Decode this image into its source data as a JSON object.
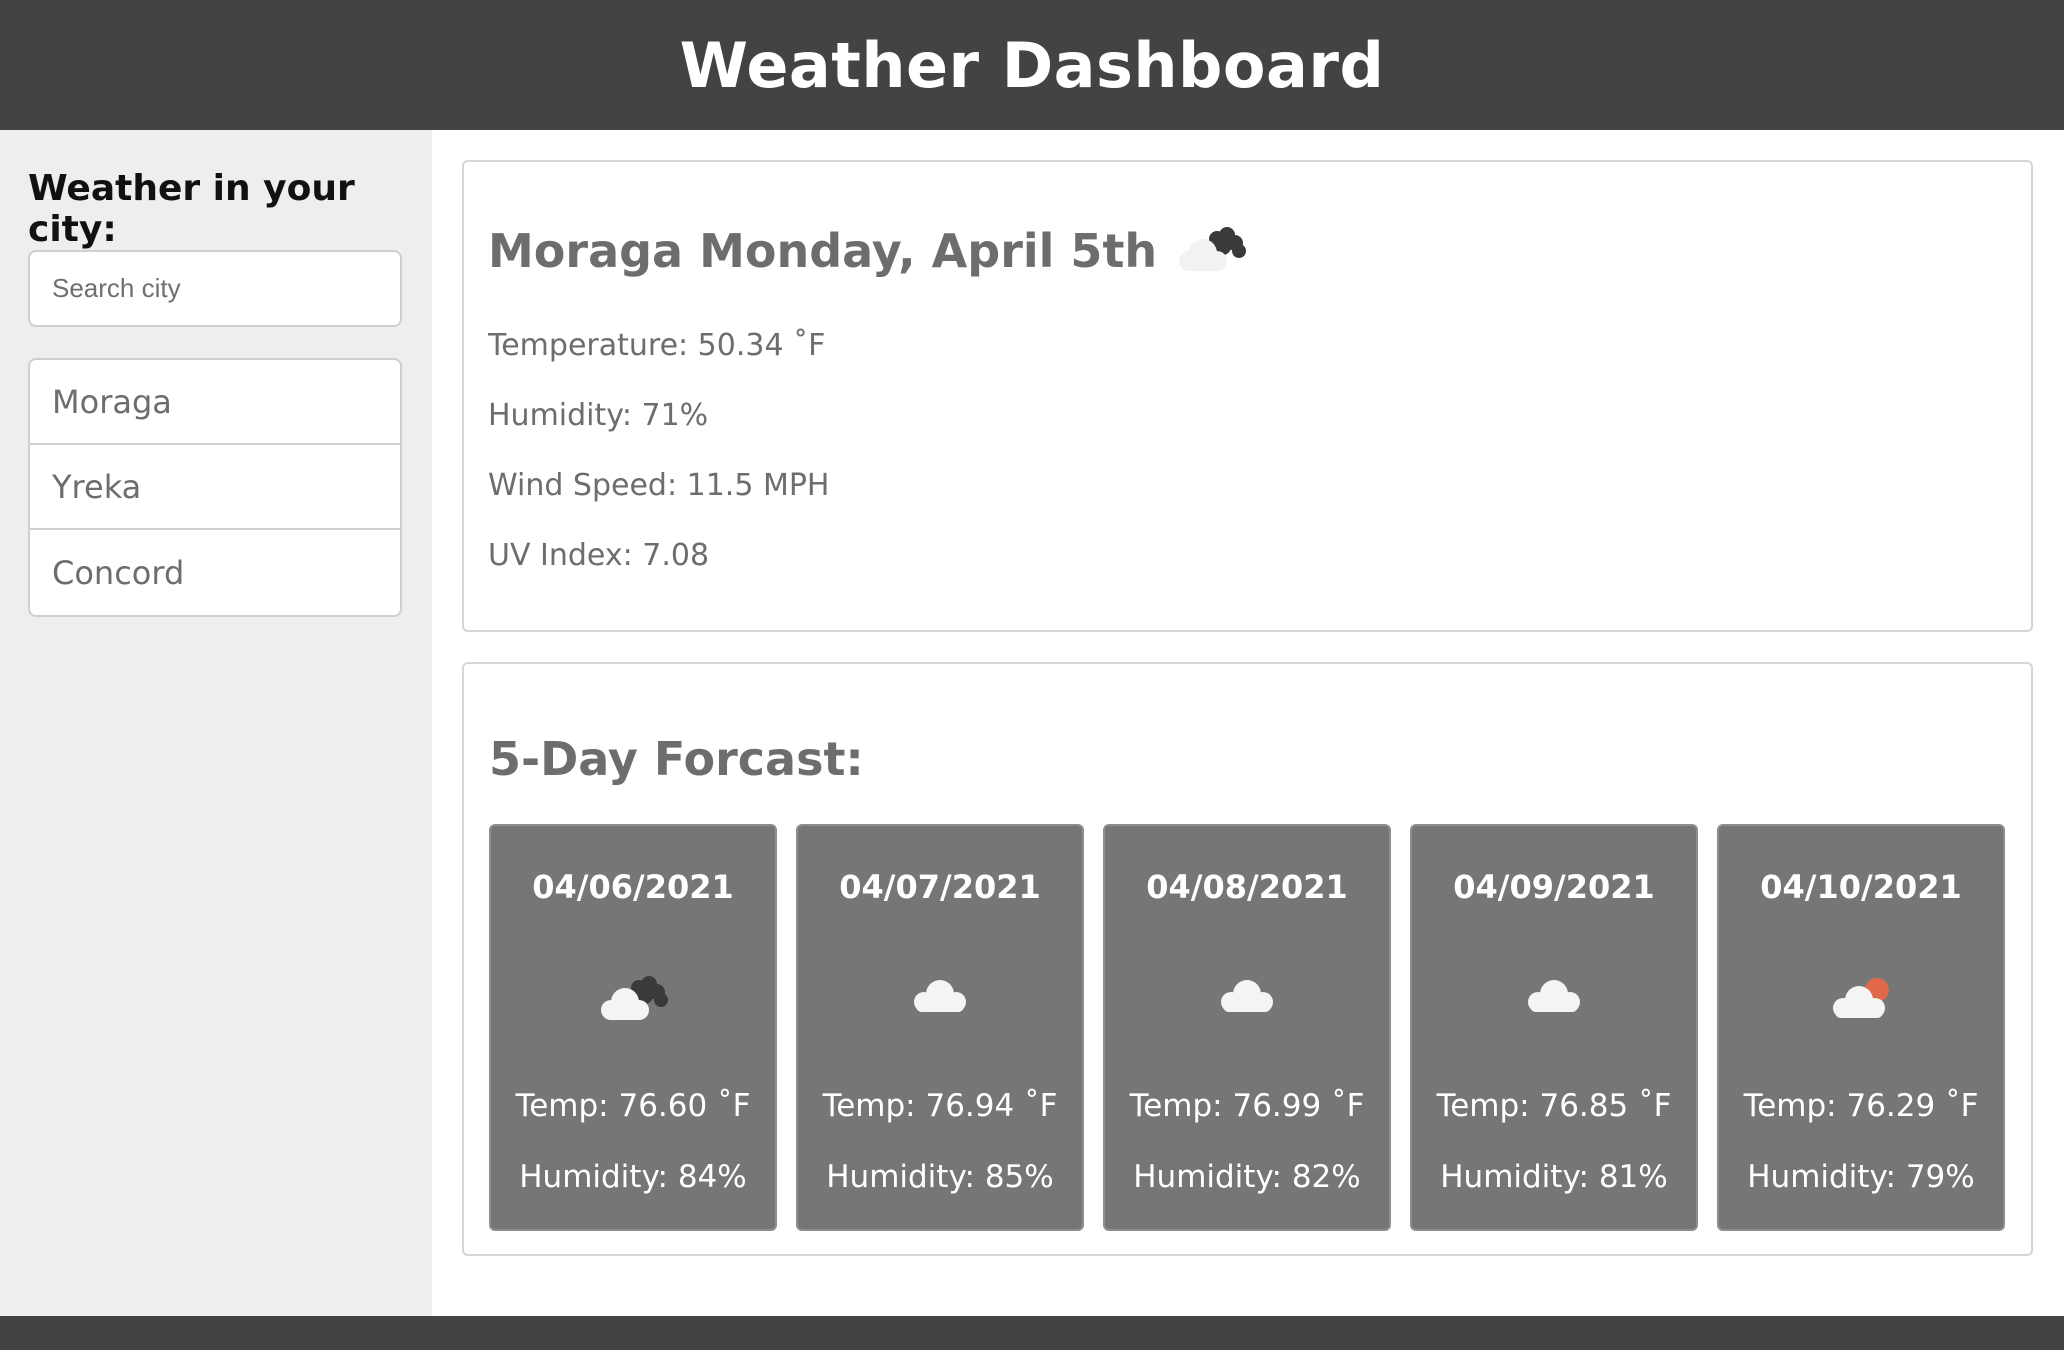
{
  "header": {
    "title": "Weather Dashboard"
  },
  "sidebar": {
    "title": "Weather in your city:",
    "search": {
      "placeholder": "Search city",
      "value": ""
    },
    "cities": [
      "Moraga",
      "Yreka",
      "Concord"
    ]
  },
  "current": {
    "title": "Moraga Monday, April 5th",
    "icon": "cloudy-night-icon",
    "temperature": "Temperature: 50.34 ˚F",
    "humidity": "Humidity: 71%",
    "wind": "Wind Speed: 11.5 MPH",
    "uv": "UV Index: 7.08"
  },
  "forecast": {
    "title": "5-Day Forcast:",
    "days": [
      {
        "date": "04/06/2021",
        "icon": "cloudy-night-icon",
        "temp": "Temp: 76.60 ˚F",
        "humidity": "Humidity: 84%"
      },
      {
        "date": "04/07/2021",
        "icon": "cloud-icon",
        "temp": "Temp: 76.94 ˚F",
        "humidity": "Humidity: 85%"
      },
      {
        "date": "04/08/2021",
        "icon": "cloud-icon",
        "temp": "Temp: 76.99 ˚F",
        "humidity": "Humidity: 82%"
      },
      {
        "date": "04/09/2021",
        "icon": "cloud-icon",
        "temp": "Temp: 76.85 ˚F",
        "humidity": "Humidity: 81%"
      },
      {
        "date": "04/10/2021",
        "icon": "partly-sunny-icon",
        "temp": "Temp: 76.29 ˚F",
        "humidity": "Humidity: 79%"
      }
    ]
  },
  "colors": {
    "header_bg": "#434343",
    "sidebar_bg": "#eeeeee",
    "card_bg": "#767676",
    "text_gray": "#6d6d6d",
    "sun": "#e0694a"
  }
}
